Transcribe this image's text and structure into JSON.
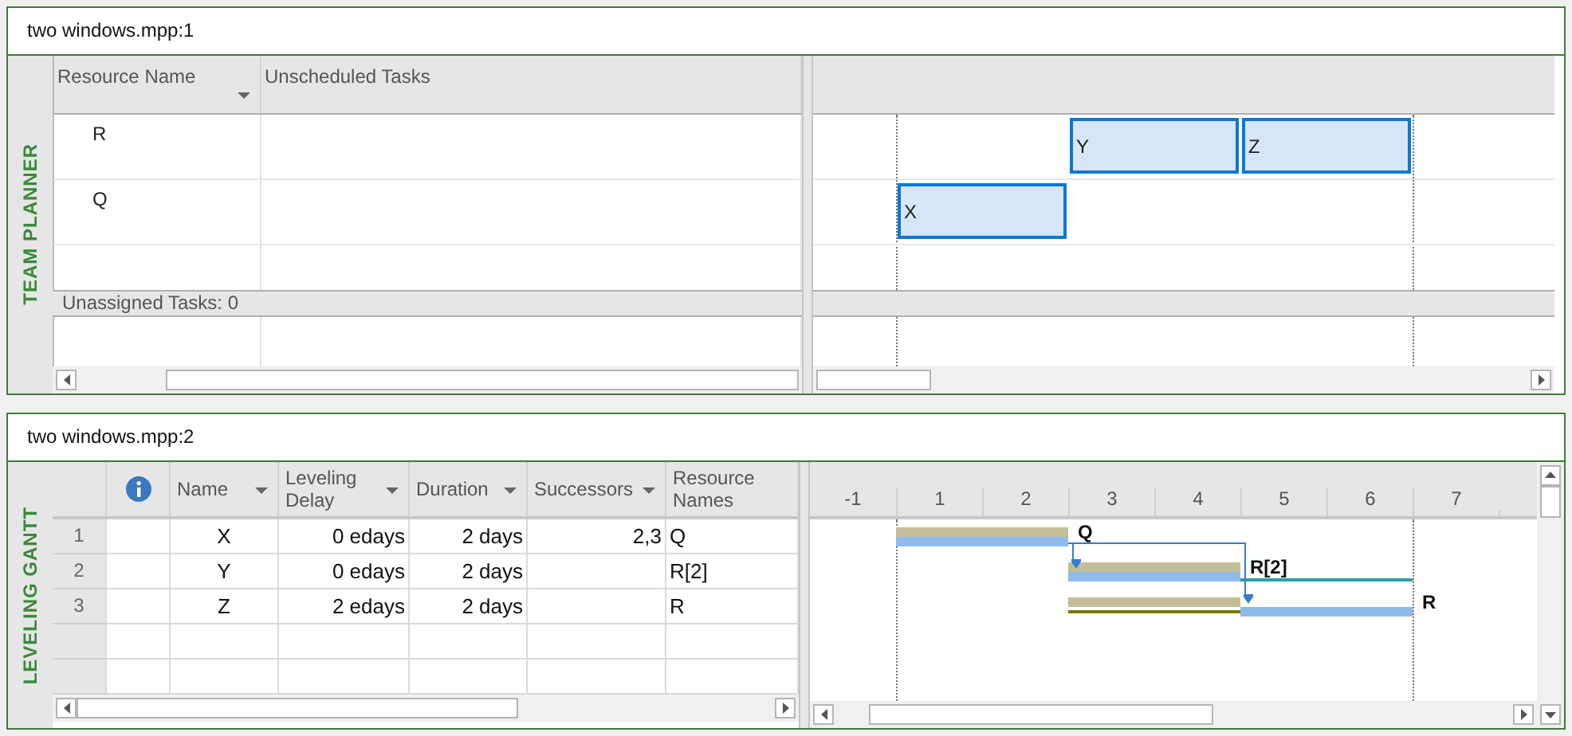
{
  "planner_window": {
    "title": "two windows.mpp:1",
    "view_label": "TEAM PLANNER",
    "columns": [
      {
        "label": "Resource Name",
        "filter": true
      },
      {
        "label": "Unscheduled Tasks",
        "filter": false
      }
    ],
    "resources": [
      {
        "name": "R",
        "tasks": [
          {
            "label": "Y"
          },
          {
            "label": "Z"
          }
        ]
      },
      {
        "name": "Q",
        "tasks": [
          {
            "label": "X"
          }
        ]
      }
    ],
    "unassigned": "Unassigned Tasks: 0"
  },
  "gantt_window": {
    "title": "two windows.mpp:2",
    "view_label": "LEVELING GANTT",
    "columns": [
      {
        "label": "Name",
        "filter": true
      },
      {
        "label": "Leveling Delay",
        "filter": true
      },
      {
        "label": "Duration",
        "filter": true
      },
      {
        "label": "Successors",
        "filter": true
      },
      {
        "label": "Resource Names",
        "filter": false
      }
    ],
    "rows": [
      {
        "row_number": "1",
        "name": "X",
        "leveling_delay": "0 edays",
        "duration": "2 days",
        "successors": "2,3",
        "resource_names": "Q",
        "bar": {
          "label": "Q",
          "leveling_delay_line": false,
          "slack_line": false
        }
      },
      {
        "row_number": "2",
        "name": "Y",
        "leveling_delay": "0 edays",
        "duration": "2 days",
        "resource_names": "R[2]",
        "bar": {
          "label": "R[2]",
          "leveling_delay_line": false,
          "slack_line": true
        }
      },
      {
        "row_number": "3",
        "name": "Z",
        "leveling_delay": "2 edays",
        "duration": "2 days",
        "resource_names": "R",
        "bar": {
          "label": "R",
          "leveling_delay_line": true,
          "slack_line": false
        }
      }
    ],
    "timescale": [
      "-1",
      "1",
      "2",
      "3",
      "4",
      "5",
      "6",
      "7"
    ]
  }
}
